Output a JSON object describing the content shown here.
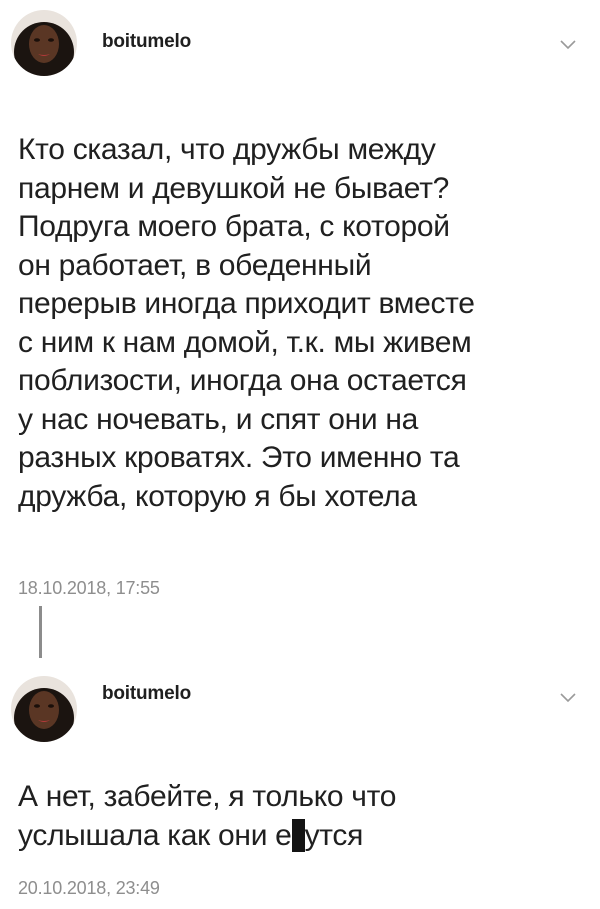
{
  "tweets": [
    {
      "username": "boitumelo",
      "text": "Кто сказал, что дружбы между\nпарнем и девушкой не бывает?\nПодруга моего брата, с которой\nон работает, в обеденный\nперерыв иногда приходит вместе\nс ним к нам домой, т.к. мы живем\nпоблизости, иногда она остается\nу нас ночевать, и спят они на\nразных кроватях. Это именно та\nдружба, которую я бы хотела",
      "timestamp": "18.10.2018, 17:55",
      "menu_icon": "chevron-down-icon",
      "avatar_icon": "avatar"
    },
    {
      "username": "boitumelo",
      "text_line1": "А нет, забейте, я только что",
      "text_line2_before": "услышала как они е",
      "text_line2_after": "утся",
      "timestamp": "20.10.2018, 23:49",
      "menu_icon": "chevron-down-icon",
      "avatar_icon": "avatar"
    }
  ],
  "colors": {
    "background": "#ffffff",
    "text": "#202020",
    "timestamp": "#8e8e8e",
    "thread_line": "#8c8c8c",
    "censor_bar": "#141414"
  }
}
